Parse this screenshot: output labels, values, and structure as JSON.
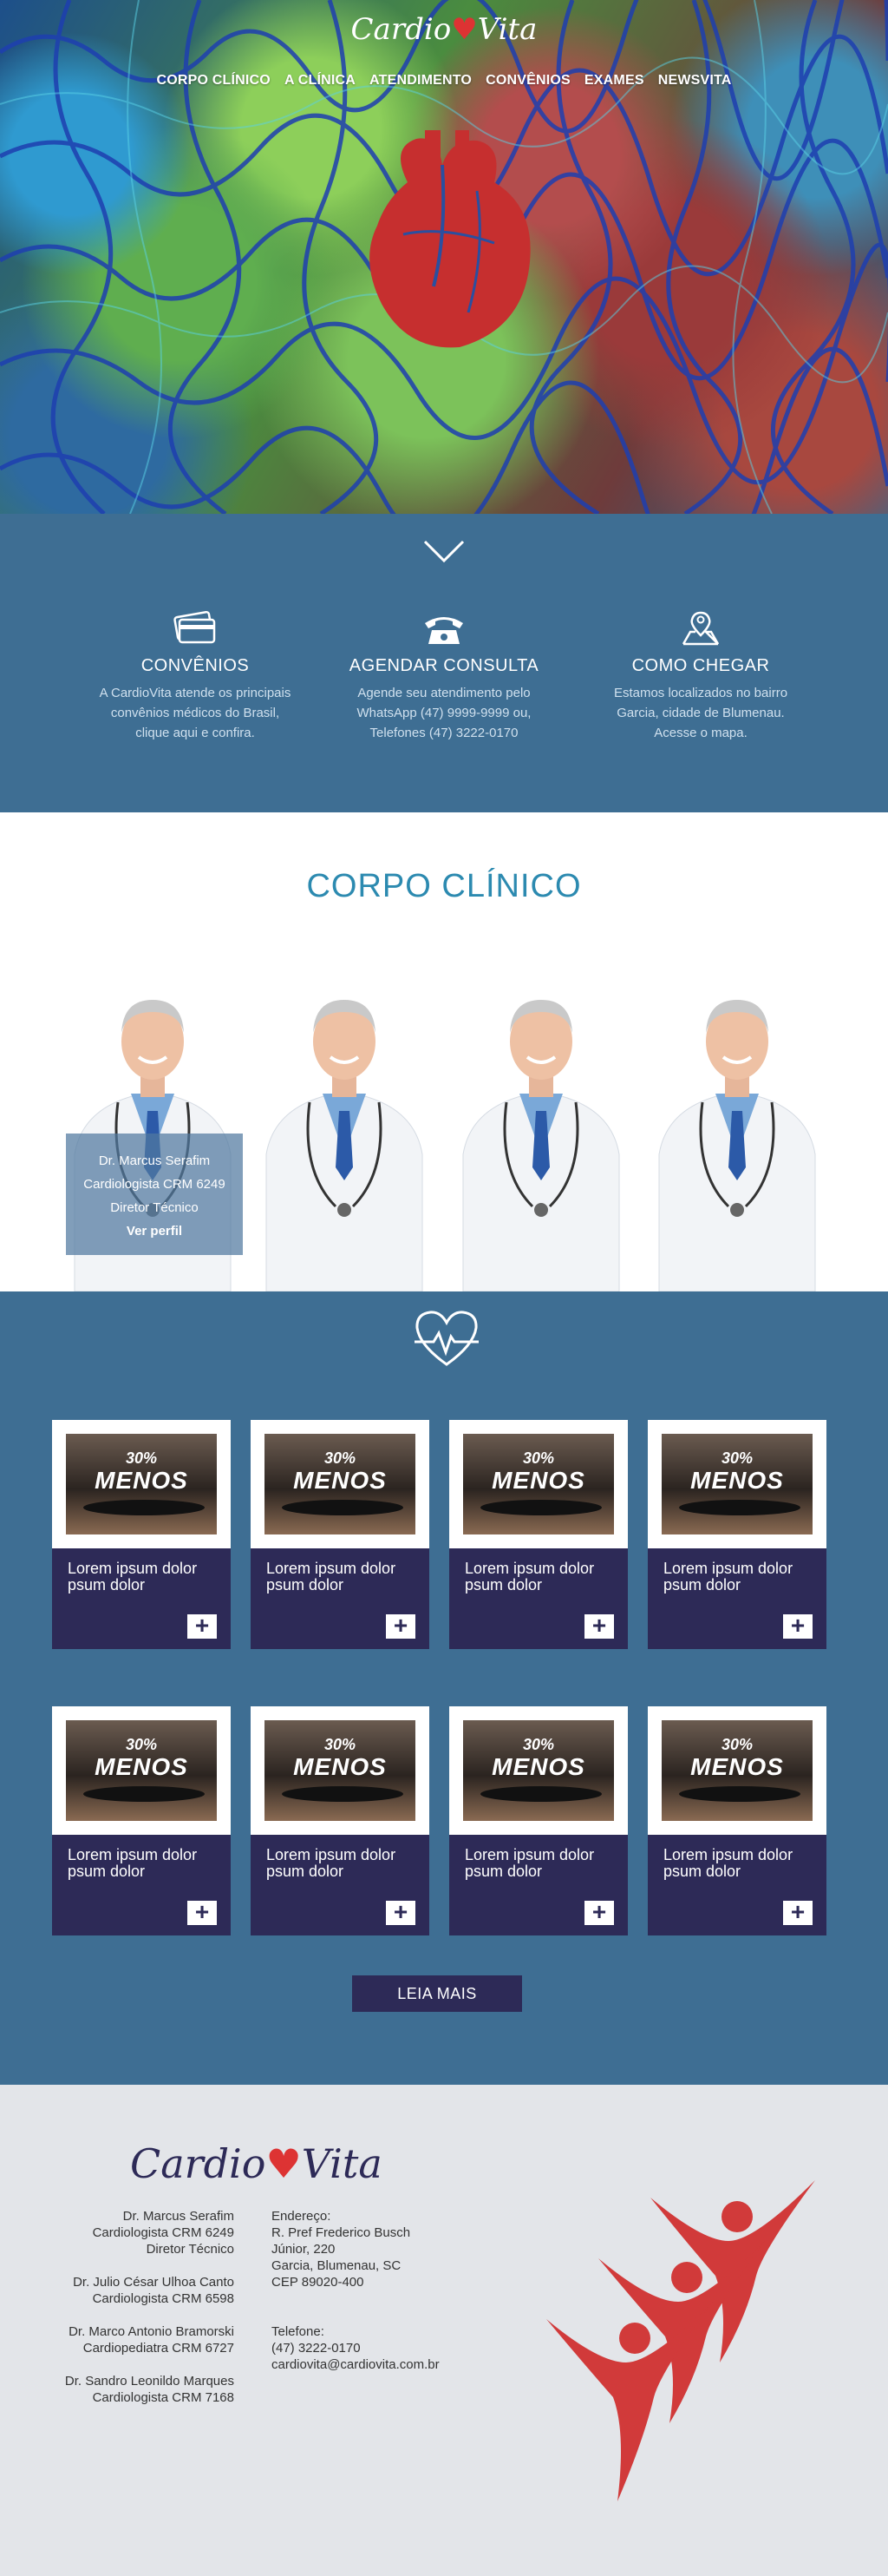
{
  "brand": {
    "logo_left": "Cardio",
    "logo_right": "Vita",
    "accent": "#d33",
    "primary_blue": "#3e6e93",
    "navy": "#2d2a57",
    "title_blue": "#2c8ab0"
  },
  "nav": {
    "items": [
      "CORPO CLÍNICO",
      "A CLÍNICA",
      "ATENDIMENTO",
      "CONVÊNIOS",
      "EXAMES",
      "NEWSVITA"
    ]
  },
  "hero": {
    "scroll_icon": "chevron-down-icon"
  },
  "features": [
    {
      "icon": "credit-card-icon",
      "title": "CONVÊNIOS",
      "lines": [
        "A CardioVita atende os principais",
        "convênios  médicos do Brasil,",
        "clique aqui e confira."
      ]
    },
    {
      "icon": "telephone-icon",
      "title": "AGENDAR CONSULTA",
      "lines": [
        "Agende seu atendimento pelo",
        "WhatsApp (47) 9999-9999 ou,",
        "Telefones (47) 3222-0170"
      ]
    },
    {
      "icon": "map-pin-icon",
      "title": "COMO CHEGAR",
      "lines": [
        "Estamos localizados no bairro",
        "Garcia, cidade de Blumenau.",
        "Acesse o mapa."
      ]
    }
  ],
  "corpo": {
    "title": "CORPO CLÍNICO",
    "featured": {
      "name": "Dr. Marcus Serafim",
      "role": "Cardiologista CRM 6249",
      "title": "Diretor Técnico",
      "link": "Ver perfil"
    }
  },
  "news": {
    "icon": "heart-pulse-icon",
    "cards": [
      {
        "badge_pct": "30%",
        "badge_word": "MENOS",
        "line1": "Lorem ipsum dolor",
        "line2": "psum dolor",
        "action": "+"
      },
      {
        "badge_pct": "30%",
        "badge_word": "MENOS",
        "line1": "Lorem ipsum dolor",
        "line2": "psum dolor",
        "action": "+"
      },
      {
        "badge_pct": "30%",
        "badge_word": "MENOS",
        "line1": "Lorem ipsum dolor",
        "line2": "psum dolor",
        "action": "+"
      },
      {
        "badge_pct": "30%",
        "badge_word": "MENOS",
        "line1": "Lorem ipsum dolor",
        "line2": "psum dolor",
        "action": "+"
      },
      {
        "badge_pct": "30%",
        "badge_word": "MENOS",
        "line1": "Lorem ipsum dolor",
        "line2": "psum dolor",
        "action": "+"
      },
      {
        "badge_pct": "30%",
        "badge_word": "MENOS",
        "line1": "Lorem ipsum dolor",
        "line2": "psum dolor",
        "action": "+"
      },
      {
        "badge_pct": "30%",
        "badge_word": "MENOS",
        "line1": "Lorem ipsum dolor",
        "line2": "psum dolor",
        "action": "+"
      },
      {
        "badge_pct": "30%",
        "badge_word": "MENOS",
        "line1": "Lorem ipsum dolor",
        "line2": "psum dolor",
        "action": "+"
      }
    ],
    "more_label": "LEIA MAIS"
  },
  "footer": {
    "doctors": [
      {
        "name": "Dr. Marcus Serafim",
        "line2": "Cardiologista CRM 6249",
        "line3": "Diretor Técnico"
      },
      {
        "name": "Dr. Julio César Ulhoa Canto",
        "line2": "Cardiologista CRM 6598"
      },
      {
        "name": "Dr. Marco Antonio Bramorski",
        "line2": "Cardiopediatra CRM 6727"
      },
      {
        "name": "Dr. Sandro Leonildo Marques",
        "line2": "Cardiologista CRM 7168"
      }
    ],
    "address_label": "Endereço:",
    "address_lines": [
      "R. Pref Frederico Busch",
      "Júnior, 220",
      "Garcia, Blumenau, SC",
      "CEP 89020-400"
    ],
    "phone_label": "Telefone:",
    "phone": "(47) 3222-0170",
    "email": "cardiovita@cardiovita.com.br"
  }
}
